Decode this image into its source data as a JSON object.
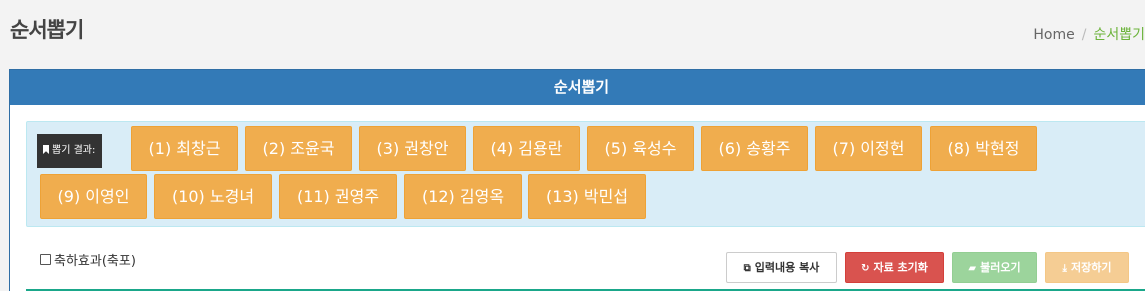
{
  "page": {
    "title": "순서뽑기"
  },
  "breadcrumb": {
    "home": "Home",
    "separator": "/",
    "current": "순서뽑기"
  },
  "panel": {
    "title": "순서뽑기"
  },
  "result": {
    "label": "뽑기 결과:",
    "picks": [
      "(1) 최창근",
      "(2) 조윤국",
      "(3) 권창안",
      "(4) 김용란",
      "(5) 육성수",
      "(6) 송황주",
      "(7) 이정헌",
      "(8) 박현정",
      "(9) 이영인",
      "(10) 노경녀",
      "(11) 권영주",
      "(12) 김영옥",
      "(13) 박민섭"
    ]
  },
  "effects": {
    "checkbox_label": "축하효과(축포)",
    "checked": false
  },
  "toolbar": {
    "copy_label": "입력내용 복사",
    "reset_label": "자료 초기화",
    "load_label": "불러오기",
    "save_label": "저장하기"
  },
  "colors": {
    "header": "#337ab7",
    "pick": "#f0ad4e",
    "reset": "#d9534f",
    "load": "#5cb85c",
    "breadcrumb_current": "#6bb33a"
  }
}
